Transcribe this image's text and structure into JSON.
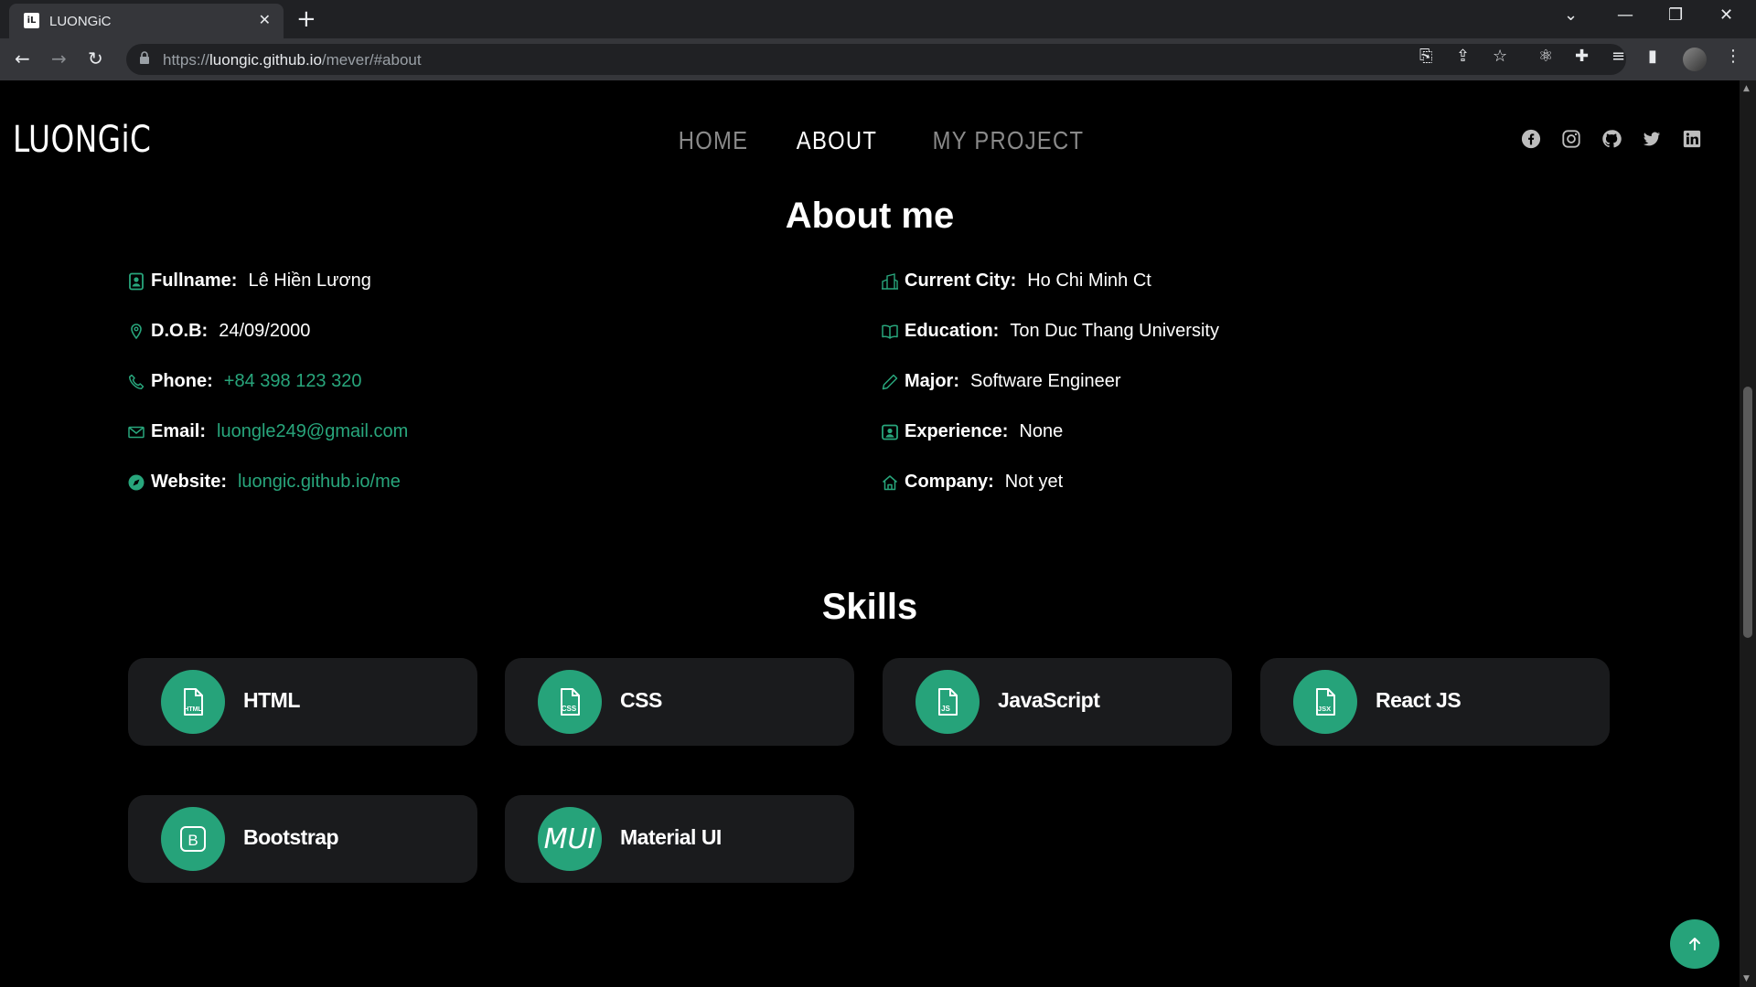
{
  "browser": {
    "tab_title": "LUONGiC",
    "tab_favicon": "iL",
    "tab_close": "✕",
    "new_tab": "+",
    "url_scheme": "https://",
    "url_host": "luongic.github.io",
    "url_path": "/mever/#about"
  },
  "header": {
    "logo": "LUONGiC",
    "nav": [
      "HOME",
      "ABOUT",
      "MY PROJECT"
    ],
    "active_nav": "ABOUT",
    "socials": [
      "facebook-icon",
      "instagram-icon",
      "github-icon",
      "twitter-icon",
      "linkedin-icon"
    ]
  },
  "about": {
    "title": "About me",
    "left": [
      {
        "icon": "person-badge-icon",
        "label": "Fullname:",
        "value": "Lê Hiền Lương",
        "link": false
      },
      {
        "icon": "location-pin-icon",
        "label": "D.O.B:",
        "value": "24/09/2000",
        "link": false
      },
      {
        "icon": "phone-icon",
        "label": "Phone:",
        "value": "+84 398 123 320",
        "link": true
      },
      {
        "icon": "envelope-icon",
        "label": "Email:",
        "value": "luongle249@gmail.com",
        "link": true
      },
      {
        "icon": "compass-icon",
        "label": "Website:",
        "value": "luongic.github.io/me",
        "link": true
      }
    ],
    "right": [
      {
        "icon": "buildings-icon",
        "label": "Current City:",
        "value": "Ho Chi Minh Ct",
        "link": false
      },
      {
        "icon": "book-icon",
        "label": "Education:",
        "value": "Ton Duc Thang University",
        "link": false
      },
      {
        "icon": "pencil-icon",
        "label": "Major:",
        "value": "Software Engineer",
        "link": false
      },
      {
        "icon": "person-badge-icon",
        "label": "Experience:",
        "value": "None",
        "link": false
      },
      {
        "icon": "house-icon",
        "label": "Company:",
        "value": "Not yet",
        "link": false
      }
    ]
  },
  "skills": {
    "title": "Skills",
    "items": [
      {
        "name": "HTML",
        "icon": "file-html-icon",
        "badge": "HTML"
      },
      {
        "name": "CSS",
        "icon": "file-css-icon",
        "badge": "CSS"
      },
      {
        "name": "JavaScript",
        "icon": "file-js-icon",
        "badge": "JS"
      },
      {
        "name": "React JS",
        "icon": "file-jsx-icon",
        "badge": "JSX"
      },
      {
        "name": "Bootstrap",
        "icon": "bootstrap-icon",
        "badge": "B"
      },
      {
        "name": "Material UI",
        "icon": "mui-icon",
        "badge": "MUI"
      }
    ]
  },
  "colors": {
    "accent": "#26a37a",
    "link": "#28a67c",
    "card": "#1a1b1d",
    "background": "#000000"
  }
}
